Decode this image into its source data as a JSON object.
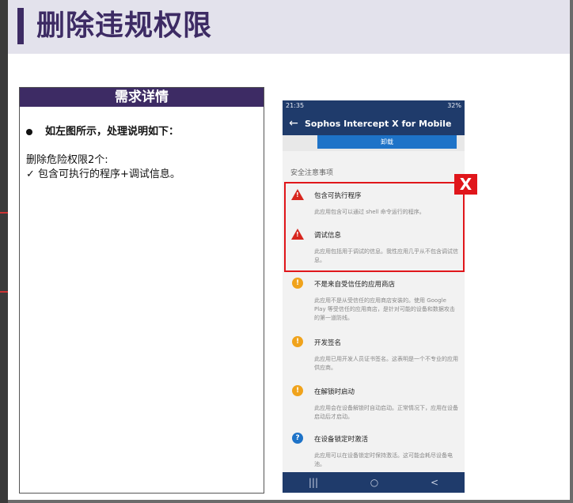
{
  "slide": {
    "title": "删除违规权限",
    "panel_header": "需求详情",
    "bullet": "如左图所示，处理说明如下：",
    "line1": "删除危险权限2个:",
    "line2": "✓  包含可执行的程序+调试信息。"
  },
  "phone": {
    "status_left": "21:35",
    "status_right": "32%",
    "app_title": "Sophos Intercept X for Mobile",
    "uninstall_label": "卸载",
    "section_title": "安全注意事项",
    "badge": "X",
    "items": [
      {
        "icon": "warning-icon",
        "title": "包含可执行程序",
        "desc": "此应用包含可以通过 shell 命令运行的程序。"
      },
      {
        "icon": "warning-icon",
        "title": "调试信息",
        "desc": "此应用包括用于调试的信息。我性应用几乎从不包含调试信息。"
      },
      {
        "icon": "alert-icon",
        "title": "不是来自受信任的应用商店",
        "desc": "此应用不是从受信任的应用商店安装的。使用 Google Play 等受信任的应用商店，是针对可能的设备和数据攻击的第一道防线。"
      },
      {
        "icon": "alert-icon",
        "title": "开发签名",
        "desc": "此应用已用开发人员证书签名。这表明是一个不专业的应用供应商。"
      },
      {
        "icon": "alert-icon",
        "title": "在解锁时启动",
        "desc": "此应用会在设备解锁时自动启动。正常情况下，应用在设备启动后才启动。"
      },
      {
        "icon": "question-icon",
        "title": "在设备锁定时激活",
        "desc": "此应用可以在设备锁定时保持激活。这可能会耗尽设备电池。"
      }
    ],
    "nav": [
      "|||",
      "○",
      "<"
    ]
  },
  "colors": {
    "accent": "#3d2b64",
    "app_bar": "#1f3b6b",
    "danger": "#e0161b",
    "warn": "#f0a31c",
    "info": "#1e73c8"
  }
}
